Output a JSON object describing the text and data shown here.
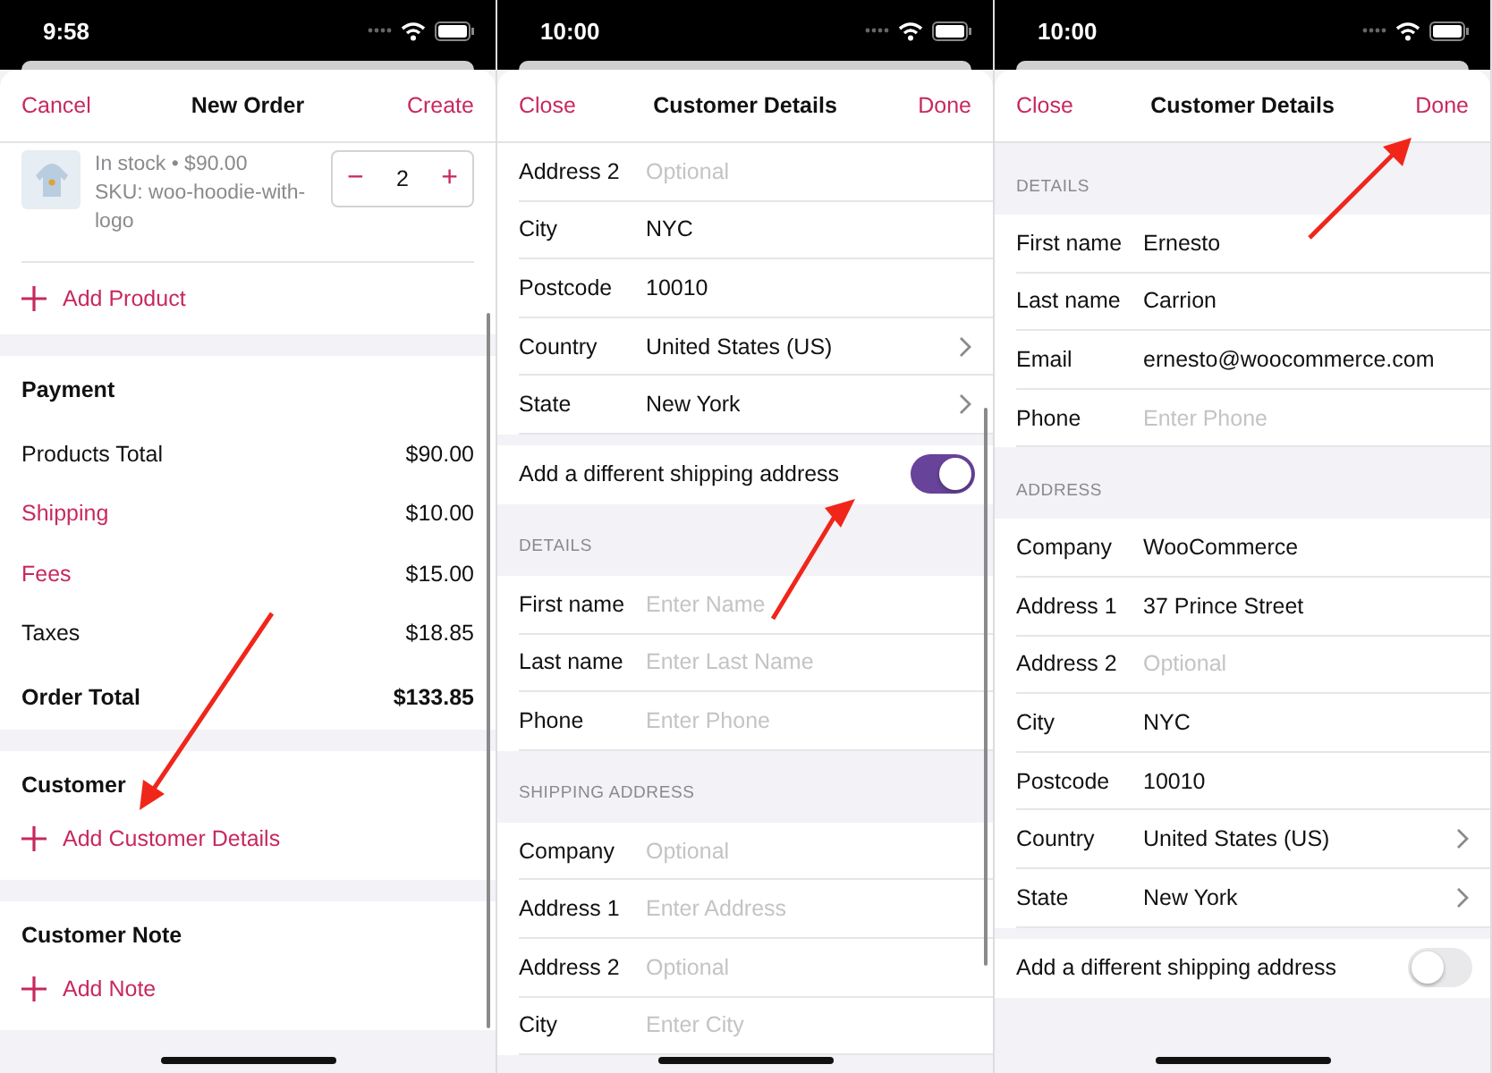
{
  "screens": [
    {
      "kind": "order",
      "time": "9:58",
      "nav": {
        "left": "Cancel",
        "title": "New Order",
        "right": "Create"
      },
      "product": {
        "stock": "In stock • $90.00",
        "sku": "SKU: woo-hoodie-with-logo",
        "quantity": "2",
        "minus": "−",
        "plus": "+"
      },
      "add_product": "Add Product",
      "payment": {
        "title": "Payment",
        "rows": [
          {
            "label": "Products Total",
            "value": "$90.00",
            "kind": "plain"
          },
          {
            "label": "Shipping",
            "value": "$10.00",
            "kind": "link"
          },
          {
            "label": "Fees",
            "value": "$15.00",
            "kind": "link"
          },
          {
            "label": "Taxes",
            "value": "$18.85",
            "kind": "plain"
          },
          {
            "label": "Order Total",
            "value": "$133.85",
            "kind": "total"
          }
        ]
      },
      "customer": {
        "title": "Customer",
        "action": "Add Customer Details"
      },
      "note": {
        "title": "Customer Note",
        "action": "Add Note"
      }
    },
    {
      "kind": "form",
      "time": "10:00",
      "nav": {
        "left": "Close",
        "title": "Customer Details",
        "right": "Done"
      },
      "items": [
        {
          "kind": "field",
          "label": "Address 2",
          "placeholder": "Optional"
        },
        {
          "kind": "field",
          "label": "City",
          "value": "NYC"
        },
        {
          "kind": "field",
          "label": "Postcode",
          "value": "10010"
        },
        {
          "kind": "picker",
          "label": "Country",
          "value": "United States (US)"
        },
        {
          "kind": "picker",
          "label": "State",
          "value": "New York"
        },
        {
          "kind": "toggle",
          "label": "Add a different shipping address",
          "on": true
        },
        {
          "kind": "header",
          "label": "DETAILS"
        },
        {
          "kind": "field",
          "label": "First name",
          "placeholder": "Enter Name"
        },
        {
          "kind": "field",
          "label": "Last name",
          "placeholder": "Enter Last Name"
        },
        {
          "kind": "field",
          "label": "Phone",
          "placeholder": "Enter Phone"
        },
        {
          "kind": "header",
          "label": "SHIPPING ADDRESS"
        },
        {
          "kind": "field",
          "label": "Company",
          "placeholder": "Optional"
        },
        {
          "kind": "field",
          "label": "Address 1",
          "placeholder": "Enter Address"
        },
        {
          "kind": "field",
          "label": "Address 2",
          "placeholder": "Optional"
        },
        {
          "kind": "field",
          "label": "City",
          "placeholder": "Enter City"
        }
      ]
    },
    {
      "kind": "form",
      "time": "10:00",
      "nav": {
        "left": "Close",
        "title": "Customer Details",
        "right": "Done"
      },
      "items": [
        {
          "kind": "header",
          "label": "DETAILS"
        },
        {
          "kind": "field",
          "label": "First name",
          "value": "Ernesto"
        },
        {
          "kind": "field",
          "label": "Last name",
          "value": "Carrion"
        },
        {
          "kind": "field",
          "label": "Email",
          "value": "ernesto@woocommerce.com"
        },
        {
          "kind": "field",
          "label": "Phone",
          "placeholder": "Enter Phone"
        },
        {
          "kind": "header",
          "label": "ADDRESS"
        },
        {
          "kind": "field",
          "label": "Company",
          "value": "WooCommerce"
        },
        {
          "kind": "field",
          "label": "Address 1",
          "value": "37 Prince Street"
        },
        {
          "kind": "field",
          "label": "Address 2",
          "placeholder": "Optional"
        },
        {
          "kind": "field",
          "label": "City",
          "value": "NYC"
        },
        {
          "kind": "field",
          "label": "Postcode",
          "value": "10010"
        },
        {
          "kind": "picker",
          "label": "Country",
          "value": "United States (US)"
        },
        {
          "kind": "picker",
          "label": "State",
          "value": "New York"
        },
        {
          "kind": "toggle",
          "label": "Add a different shipping address",
          "on": false
        }
      ]
    }
  ]
}
